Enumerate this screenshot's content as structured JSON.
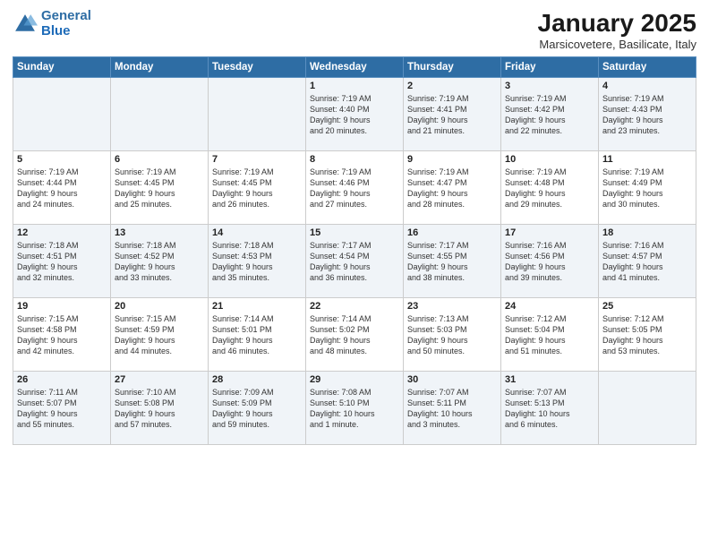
{
  "logo": {
    "line1": "General",
    "line2": "Blue"
  },
  "title": "January 2025",
  "location": "Marsicovetere, Basilicate, Italy",
  "weekdays": [
    "Sunday",
    "Monday",
    "Tuesday",
    "Wednesday",
    "Thursday",
    "Friday",
    "Saturday"
  ],
  "weeks": [
    [
      {
        "day": "",
        "text": ""
      },
      {
        "day": "",
        "text": ""
      },
      {
        "day": "",
        "text": ""
      },
      {
        "day": "1",
        "text": "Sunrise: 7:19 AM\nSunset: 4:40 PM\nDaylight: 9 hours\nand 20 minutes."
      },
      {
        "day": "2",
        "text": "Sunrise: 7:19 AM\nSunset: 4:41 PM\nDaylight: 9 hours\nand 21 minutes."
      },
      {
        "day": "3",
        "text": "Sunrise: 7:19 AM\nSunset: 4:42 PM\nDaylight: 9 hours\nand 22 minutes."
      },
      {
        "day": "4",
        "text": "Sunrise: 7:19 AM\nSunset: 4:43 PM\nDaylight: 9 hours\nand 23 minutes."
      }
    ],
    [
      {
        "day": "5",
        "text": "Sunrise: 7:19 AM\nSunset: 4:44 PM\nDaylight: 9 hours\nand 24 minutes."
      },
      {
        "day": "6",
        "text": "Sunrise: 7:19 AM\nSunset: 4:45 PM\nDaylight: 9 hours\nand 25 minutes."
      },
      {
        "day": "7",
        "text": "Sunrise: 7:19 AM\nSunset: 4:45 PM\nDaylight: 9 hours\nand 26 minutes."
      },
      {
        "day": "8",
        "text": "Sunrise: 7:19 AM\nSunset: 4:46 PM\nDaylight: 9 hours\nand 27 minutes."
      },
      {
        "day": "9",
        "text": "Sunrise: 7:19 AM\nSunset: 4:47 PM\nDaylight: 9 hours\nand 28 minutes."
      },
      {
        "day": "10",
        "text": "Sunrise: 7:19 AM\nSunset: 4:48 PM\nDaylight: 9 hours\nand 29 minutes."
      },
      {
        "day": "11",
        "text": "Sunrise: 7:19 AM\nSunset: 4:49 PM\nDaylight: 9 hours\nand 30 minutes."
      }
    ],
    [
      {
        "day": "12",
        "text": "Sunrise: 7:18 AM\nSunset: 4:51 PM\nDaylight: 9 hours\nand 32 minutes."
      },
      {
        "day": "13",
        "text": "Sunrise: 7:18 AM\nSunset: 4:52 PM\nDaylight: 9 hours\nand 33 minutes."
      },
      {
        "day": "14",
        "text": "Sunrise: 7:18 AM\nSunset: 4:53 PM\nDaylight: 9 hours\nand 35 minutes."
      },
      {
        "day": "15",
        "text": "Sunrise: 7:17 AM\nSunset: 4:54 PM\nDaylight: 9 hours\nand 36 minutes."
      },
      {
        "day": "16",
        "text": "Sunrise: 7:17 AM\nSunset: 4:55 PM\nDaylight: 9 hours\nand 38 minutes."
      },
      {
        "day": "17",
        "text": "Sunrise: 7:16 AM\nSunset: 4:56 PM\nDaylight: 9 hours\nand 39 minutes."
      },
      {
        "day": "18",
        "text": "Sunrise: 7:16 AM\nSunset: 4:57 PM\nDaylight: 9 hours\nand 41 minutes."
      }
    ],
    [
      {
        "day": "19",
        "text": "Sunrise: 7:15 AM\nSunset: 4:58 PM\nDaylight: 9 hours\nand 42 minutes."
      },
      {
        "day": "20",
        "text": "Sunrise: 7:15 AM\nSunset: 4:59 PM\nDaylight: 9 hours\nand 44 minutes."
      },
      {
        "day": "21",
        "text": "Sunrise: 7:14 AM\nSunset: 5:01 PM\nDaylight: 9 hours\nand 46 minutes."
      },
      {
        "day": "22",
        "text": "Sunrise: 7:14 AM\nSunset: 5:02 PM\nDaylight: 9 hours\nand 48 minutes."
      },
      {
        "day": "23",
        "text": "Sunrise: 7:13 AM\nSunset: 5:03 PM\nDaylight: 9 hours\nand 50 minutes."
      },
      {
        "day": "24",
        "text": "Sunrise: 7:12 AM\nSunset: 5:04 PM\nDaylight: 9 hours\nand 51 minutes."
      },
      {
        "day": "25",
        "text": "Sunrise: 7:12 AM\nSunset: 5:05 PM\nDaylight: 9 hours\nand 53 minutes."
      }
    ],
    [
      {
        "day": "26",
        "text": "Sunrise: 7:11 AM\nSunset: 5:07 PM\nDaylight: 9 hours\nand 55 minutes."
      },
      {
        "day": "27",
        "text": "Sunrise: 7:10 AM\nSunset: 5:08 PM\nDaylight: 9 hours\nand 57 minutes."
      },
      {
        "day": "28",
        "text": "Sunrise: 7:09 AM\nSunset: 5:09 PM\nDaylight: 9 hours\nand 59 minutes."
      },
      {
        "day": "29",
        "text": "Sunrise: 7:08 AM\nSunset: 5:10 PM\nDaylight: 10 hours\nand 1 minute."
      },
      {
        "day": "30",
        "text": "Sunrise: 7:07 AM\nSunset: 5:11 PM\nDaylight: 10 hours\nand 3 minutes."
      },
      {
        "day": "31",
        "text": "Sunrise: 7:07 AM\nSunset: 5:13 PM\nDaylight: 10 hours\nand 6 minutes."
      },
      {
        "day": "",
        "text": ""
      }
    ]
  ]
}
